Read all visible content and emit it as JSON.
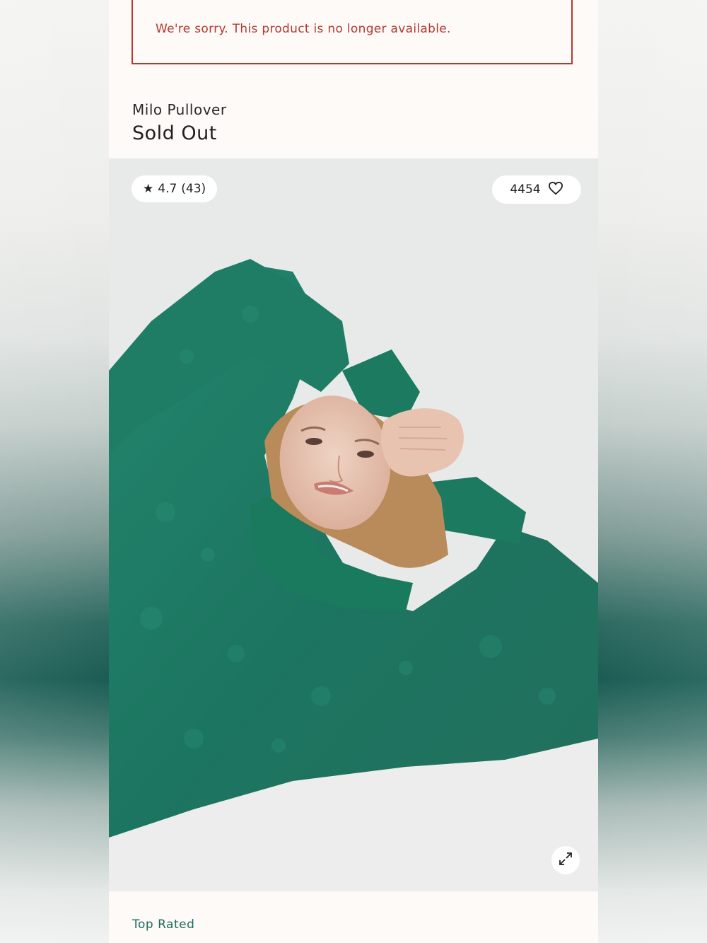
{
  "alert": {
    "message": "We're sorry. This product is no longer available."
  },
  "product": {
    "name": "Milo Pullover",
    "status": "Sold Out"
  },
  "image_overlay": {
    "rating": "4.7",
    "review_count": "(43)",
    "favorites_count": "4454"
  },
  "badge": {
    "label": "Top Rated"
  },
  "icons": [
    "star-icon",
    "heart-icon",
    "expand-icon"
  ],
  "colors": {
    "alert": "#b5392f",
    "accent_green": "#1e6b5c",
    "sweater_green": "#1f7a63",
    "page_background": "#fdfaf8"
  }
}
